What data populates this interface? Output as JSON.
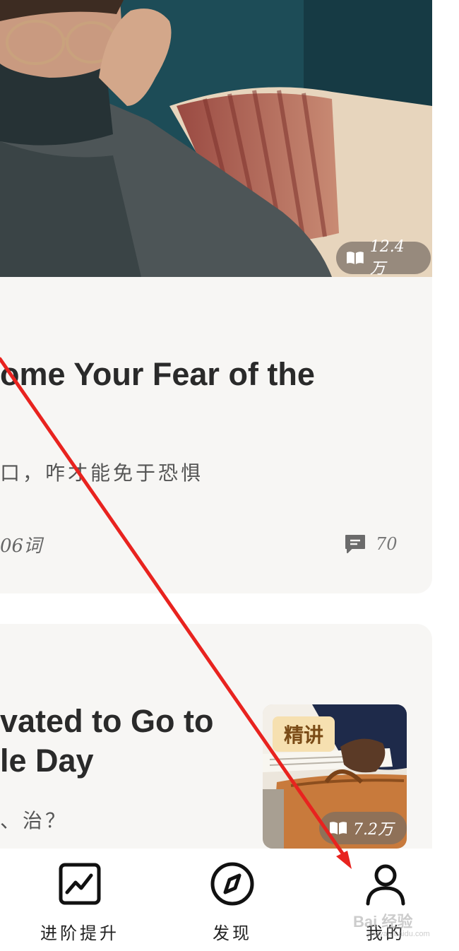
{
  "hero": {
    "read_count": "12.4万"
  },
  "article1": {
    "title": "ome Your Fear of the",
    "subtitle": "口，咋才能免于恐惧",
    "word_count": "06词",
    "comment_count": "70"
  },
  "article2": {
    "title_line1": "vated to Go to",
    "title_line2": "le Day",
    "subtitle": "、治？",
    "tag": "精讲",
    "read_count": "7.2万"
  },
  "bottom_nav": {
    "items": [
      {
        "label": "进阶提升",
        "icon": "chart-trend-icon"
      },
      {
        "label": "发现",
        "icon": "compass-icon"
      },
      {
        "label": "我的",
        "icon": "user-icon"
      }
    ]
  },
  "annotation": {
    "color": "#e8231f"
  },
  "watermark": {
    "text": "Bai 经验",
    "url": "jingyan.baidu.com"
  }
}
